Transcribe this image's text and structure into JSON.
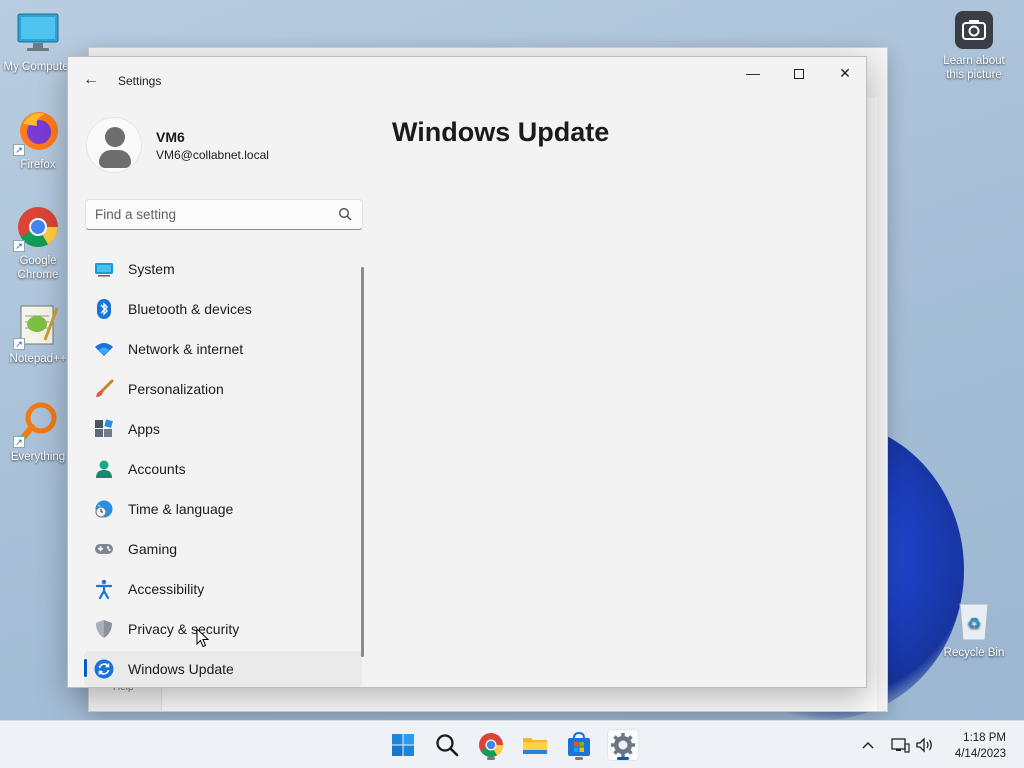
{
  "desktop": {
    "icons": [
      {
        "label": "My Computer"
      },
      {
        "label": "Firefox"
      },
      {
        "label": "Google Chrome"
      },
      {
        "label": "Notepad++"
      },
      {
        "label": "Everything"
      },
      {
        "label": "Learn about this picture"
      },
      {
        "label": "Recycle Bin"
      }
    ]
  },
  "back_window": {
    "help_label": "Help"
  },
  "window": {
    "title": "Settings",
    "controls": {
      "minimize": "—",
      "close": "✕"
    },
    "profile": {
      "name": "VM6",
      "email": "VM6@collabnet.local"
    },
    "search": {
      "placeholder": "Find a setting"
    },
    "nav": [
      {
        "label": "System",
        "icon": "system-icon"
      },
      {
        "label": "Bluetooth & devices",
        "icon": "bluetooth-icon"
      },
      {
        "label": "Network & internet",
        "icon": "wifi-icon"
      },
      {
        "label": "Personalization",
        "icon": "brush-icon"
      },
      {
        "label": "Apps",
        "icon": "apps-icon"
      },
      {
        "label": "Accounts",
        "icon": "accounts-icon"
      },
      {
        "label": "Time & language",
        "icon": "time-language-icon"
      },
      {
        "label": "Gaming",
        "icon": "gamepad-icon"
      },
      {
        "label": "Accessibility",
        "icon": "accessibility-icon"
      },
      {
        "label": "Privacy & security",
        "icon": "shield-icon"
      },
      {
        "label": "Windows Update",
        "icon": "update-icon",
        "active": true
      }
    ],
    "page_title": "Windows Update"
  },
  "taskbar": {
    "apps": [
      "start-icon",
      "search-icon",
      "chrome-icon",
      "file-explorer-icon",
      "store-icon",
      "settings-icon"
    ],
    "clock": {
      "time": "1:18 PM",
      "date": "4/14/2023"
    }
  },
  "colors": {
    "accent": "#005fb8",
    "desktop": "#a8c0d8"
  }
}
